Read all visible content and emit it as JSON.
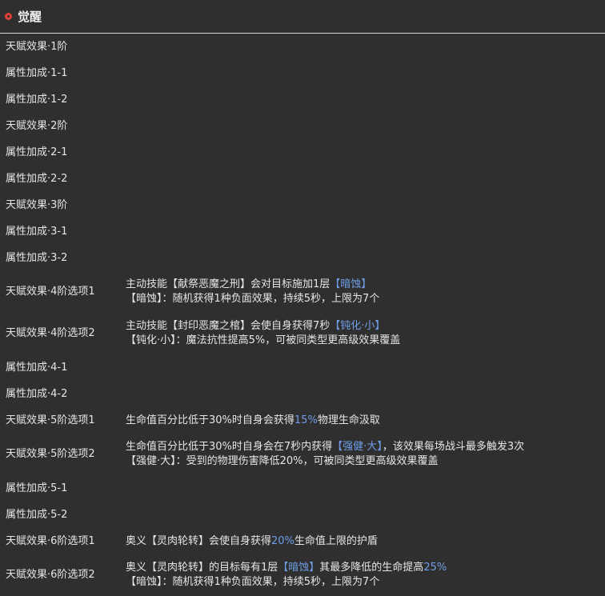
{
  "section": {
    "title": "觉醒"
  },
  "rows": [
    {
      "label": "天赋效果·1阶"
    },
    {
      "label": "属性加成·1-1"
    },
    {
      "label": "属性加成·1-2"
    },
    {
      "label": "天赋效果·2阶"
    },
    {
      "label": "属性加成·2-1"
    },
    {
      "label": "属性加成·2-2"
    },
    {
      "label": "天赋效果·3阶"
    },
    {
      "label": "属性加成·3-1"
    },
    {
      "label": "属性加成·3-2"
    },
    {
      "label": "天赋效果·4阶选项1",
      "l1a": "主动技能【献祭恶魔之刑】会对目标施加1层",
      "l1h": "【暗蚀】",
      "l2": "【暗蚀】：随机获得1种负面效果，持续5秒，上限为7个"
    },
    {
      "label": "天赋效果·4阶选项2",
      "l1a": "主动技能【封印恶魔之棺】会使自身获得7秒",
      "l1h": "【钝化·小】",
      "l2": "【钝化·小】：魔法抗性提高5%，可被同类型更高级效果覆盖"
    },
    {
      "label": "属性加成·4-1"
    },
    {
      "label": "属性加成·4-2"
    },
    {
      "label": "天赋效果·5阶选项1",
      "l1a": "生命值百分比低于30%时自身会获得",
      "l1h": "15%",
      "l1c": "物理生命汲取"
    },
    {
      "label": "天赋效果·5阶选项2",
      "l1a": "生命值百分比低于30%时自身会在7秒内获得",
      "l1h": "【强健·大】",
      "l1c": "，该效果每场战斗最多触发3次",
      "l2": "【强健·大】：受到的物理伤害降低20%，可被同类型更高级效果覆盖"
    },
    {
      "label": "属性加成·5-1"
    },
    {
      "label": "属性加成·5-2"
    },
    {
      "label": "天赋效果·6阶选项1",
      "l1a": "奥义【灵肉轮转】会使自身获得",
      "l1h": "20%",
      "l1c": "生命值上限的护盾"
    },
    {
      "label": "天赋效果·6阶选项2",
      "l1a": "奥义【灵肉轮转】的目标每有1层",
      "l1h": "【暗蚀】",
      "l1c": "其最多降低的生命提高",
      "l1h2": "25%",
      "l2": "【暗蚀】：随机获得1种负面效果，持续5秒，上限为7个"
    }
  ],
  "colors": {
    "highlight": "#6f9ee8",
    "background": "#2f2f2f",
    "accent": "#e0403a"
  },
  "icons": {
    "section": "circle-bullet-icon"
  }
}
